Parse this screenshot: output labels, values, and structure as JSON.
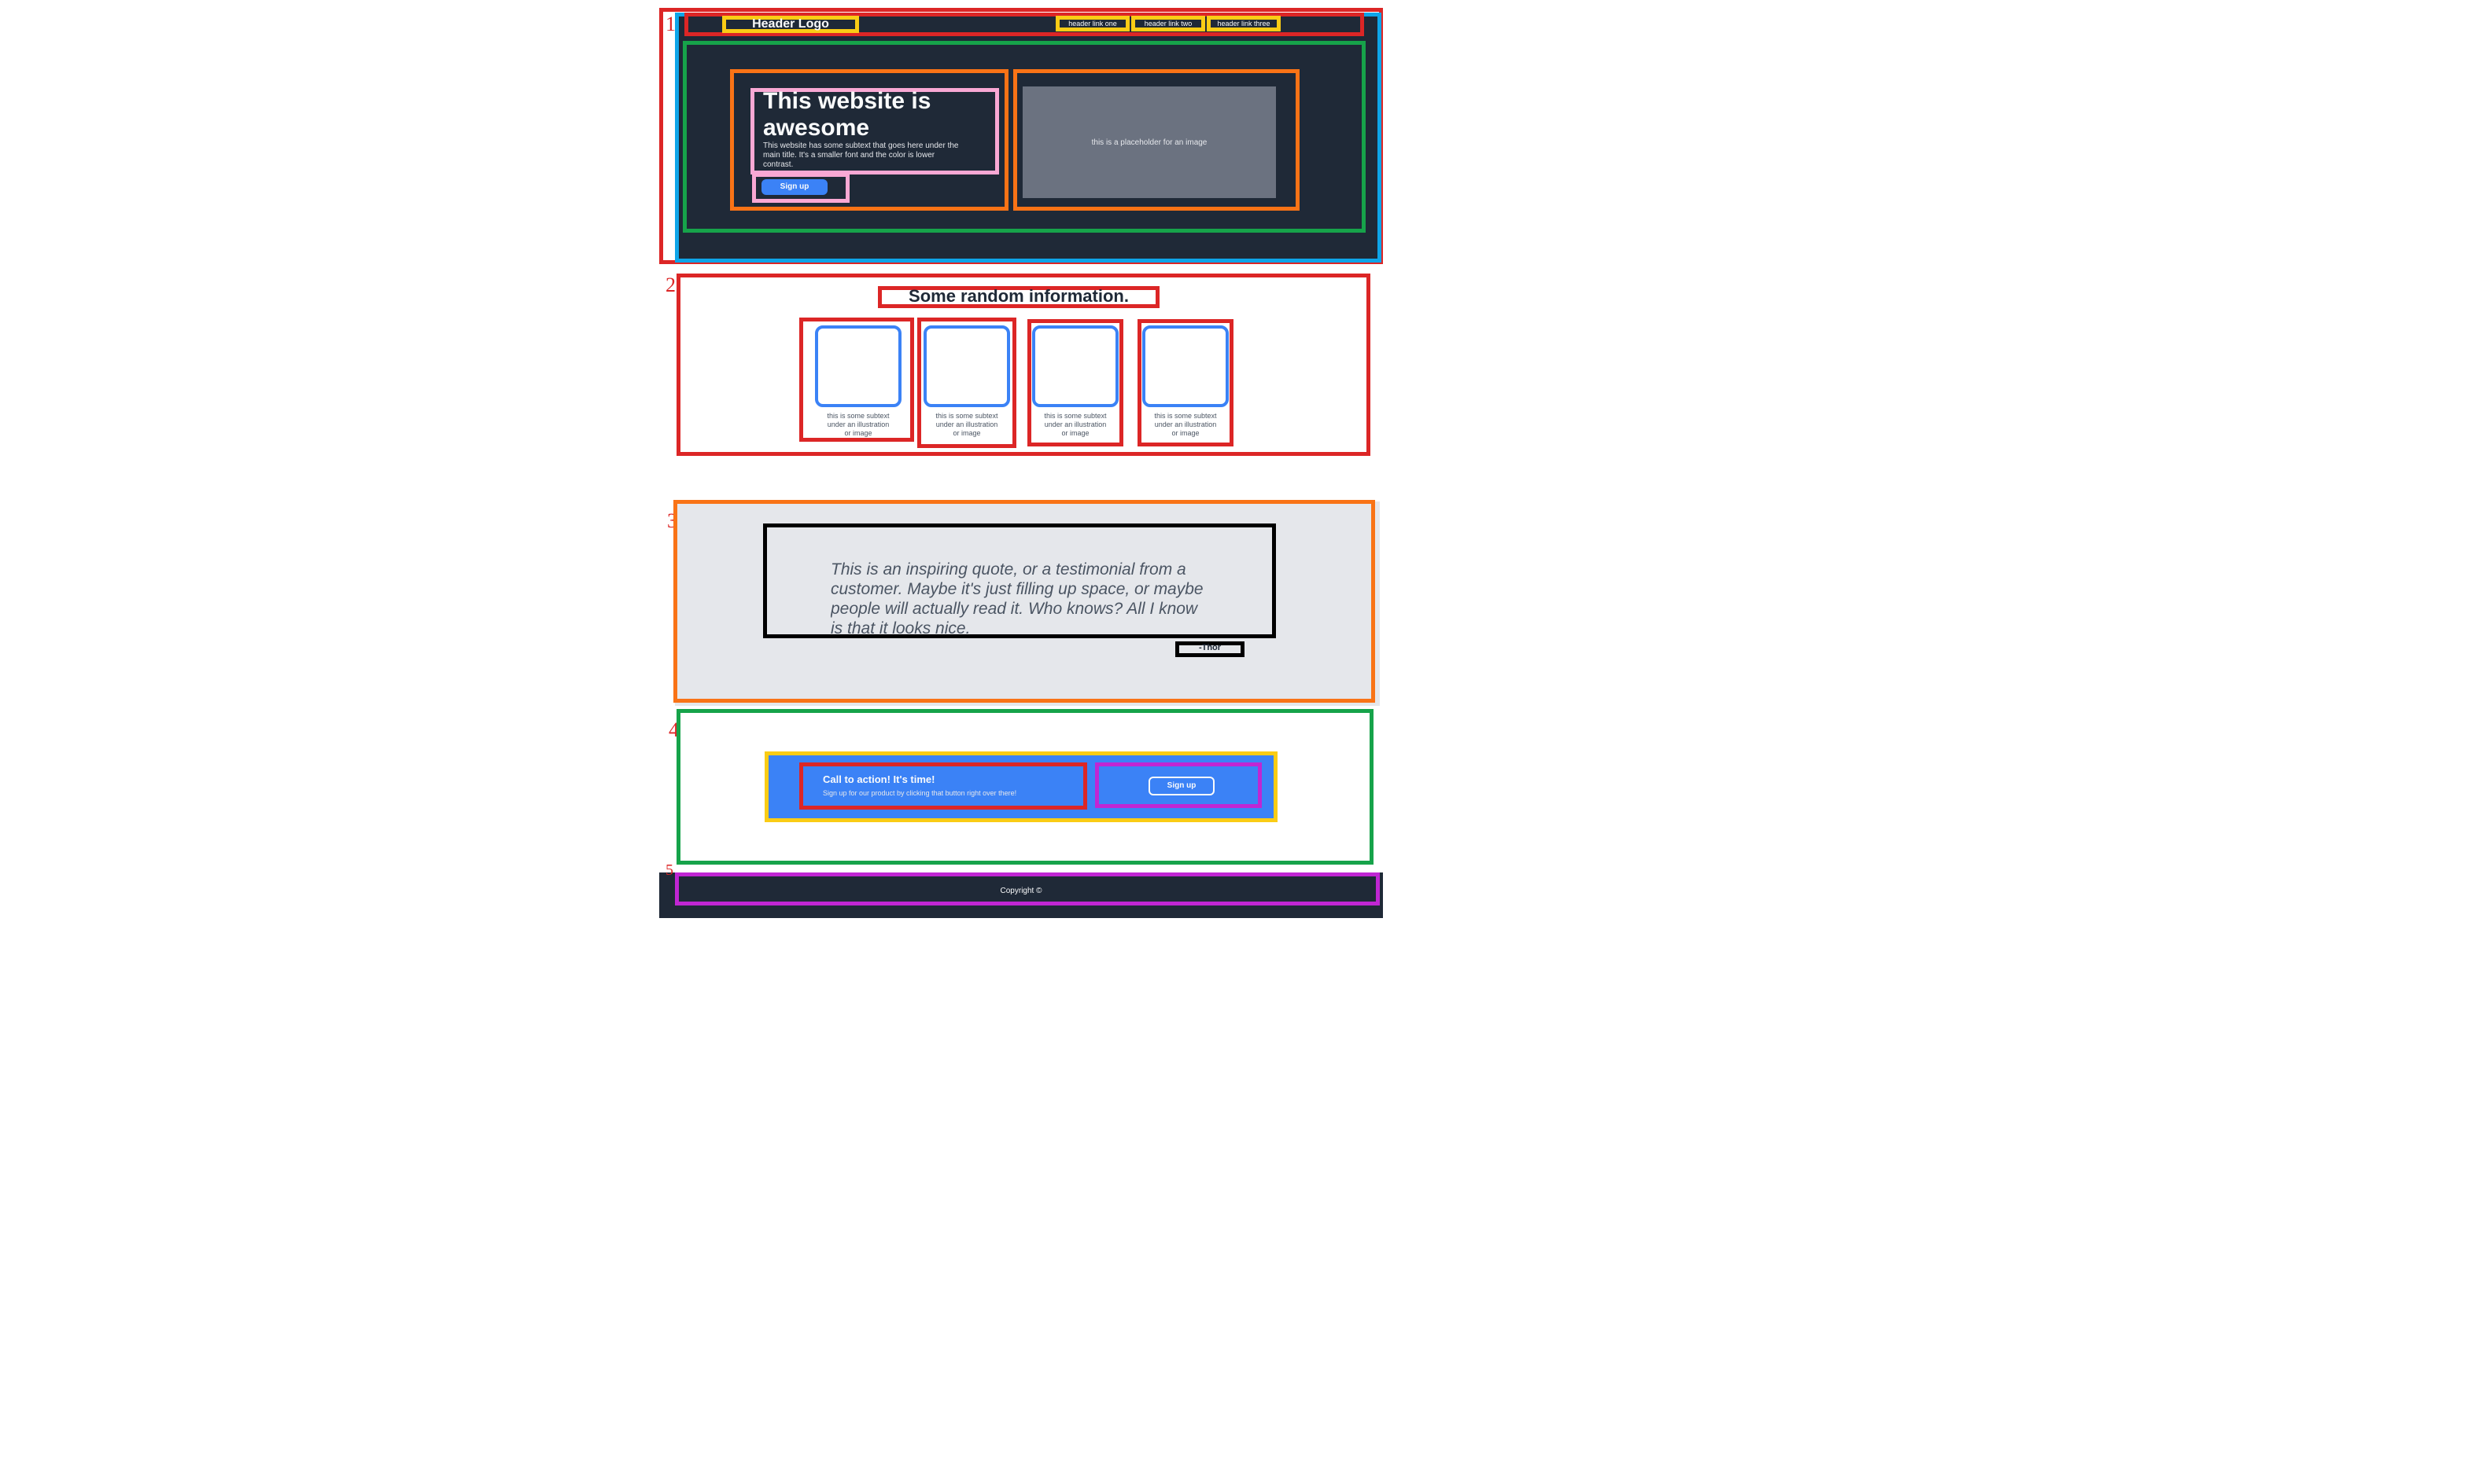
{
  "header": {
    "logo": "Header Logo",
    "links": [
      "header link one",
      "header link two",
      "header link three"
    ]
  },
  "hero": {
    "title_line1": "This website is",
    "title_line2": "awesome",
    "subtext_lines": [
      "This website has some subtext that goes here under the",
      "main title.  It's a smaller font and the color is lower",
      "contrast."
    ],
    "button": "Sign up",
    "image_placeholder": "this is a placeholder for an image"
  },
  "info": {
    "title": "Some random information.",
    "cards": [
      {
        "line1": "this is some subtext",
        "line2": "under an illustration",
        "line3": "or image"
      },
      {
        "line1": "this is some subtext",
        "line2": "under an illustration",
        "line3": "or image"
      },
      {
        "line1": "this is some subtext",
        "line2": "under an illustration",
        "line3": "or image"
      },
      {
        "line1": "this is some subtext",
        "line2": "under an illustration",
        "line3": "or image"
      }
    ]
  },
  "quote": {
    "lines": [
      "This is an inspiring quote, or a testimonial from a",
      "customer.  Maybe it's just filling up space, or maybe",
      "people will actually read it. Who knows?  All I know",
      "is that it looks nice."
    ],
    "author": "-Thor"
  },
  "cta": {
    "title": "Call to action! It's time!",
    "subtext": "Sign up for our product by clicking that button right over there!",
    "button": "Sign up"
  },
  "footer": {
    "copyright": "Copyright ©"
  },
  "markers": [
    "1",
    "2",
    "3",
    "4",
    "5"
  ],
  "colors": {
    "dark": "#1f2937",
    "accent": "#3b82f6",
    "gray": "#e5e7eb"
  }
}
